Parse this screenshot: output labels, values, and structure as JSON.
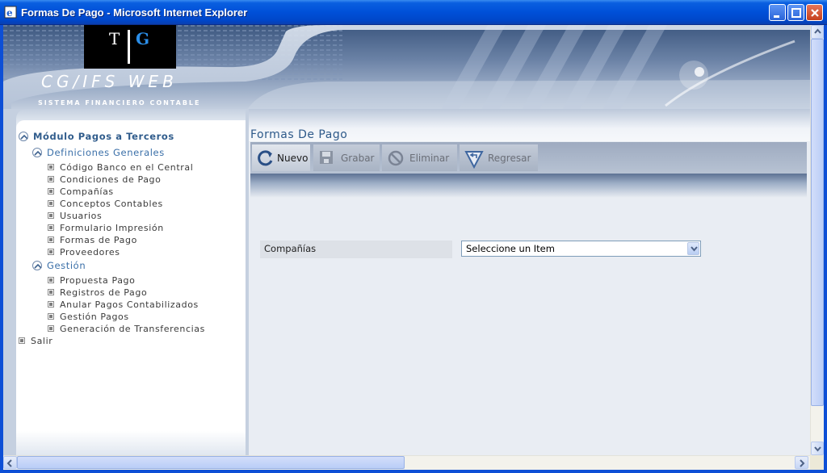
{
  "window": {
    "title": "Formas De Pago - Microsoft Internet Explorer"
  },
  "banner": {
    "logo_left": "T",
    "logo_right": "G",
    "app_name": "CG/IFS WEB",
    "subtitle": "SISTEMA FINANCIERO CONTABLE"
  },
  "sidebar": {
    "module": "Módulo Pagos a Terceros",
    "sections": [
      {
        "label": "Definiciones Generales",
        "items": [
          "Código Banco en el Central",
          "Condiciones de Pago",
          "Compañías",
          "Conceptos Contables",
          "Usuarios",
          "Formulario Impresión",
          "Formas de Pago",
          "Proveedores"
        ]
      },
      {
        "label": "Gestión",
        "items": [
          "Propuesta Pago",
          "Registros de Pago",
          "Anular Pagos Contabilizados",
          "Gestión Pagos",
          "Generación de Transferencias"
        ]
      }
    ],
    "exit": "Salir"
  },
  "content": {
    "title": "Formas De Pago",
    "toolbar": {
      "nuevo": "Nuevo",
      "grabar": "Grabar",
      "eliminar": "Eliminar",
      "regresar": "Regresar"
    },
    "form": {
      "label": "Compañías",
      "select_value": "Seleccione un Item"
    }
  },
  "colors": {
    "titlebar": "#0050d8",
    "accent_text": "#2e5a8a",
    "sidebar_bg": "#ffffff"
  }
}
